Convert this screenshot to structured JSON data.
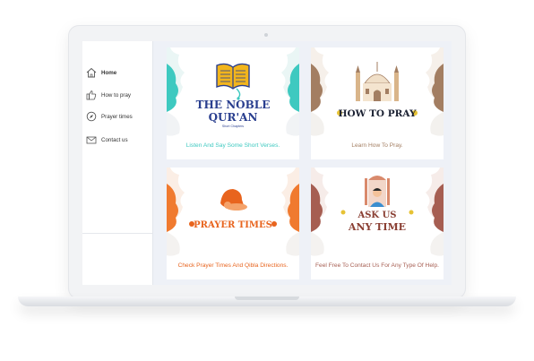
{
  "sidebar": {
    "items": [
      {
        "label": "Home",
        "icon": "home-icon"
      },
      {
        "label": "How to pray",
        "icon": "thumbs-up-icon"
      },
      {
        "label": "Prayer times",
        "icon": "compass-icon"
      },
      {
        "label": "Contact us",
        "icon": "envelope-icon"
      }
    ]
  },
  "cards": [
    {
      "title_line1": "THE NOBLE",
      "title_line2": "QUR'AN",
      "subtitle": "Short Chapters",
      "caption": "Listen And Say Some Short Verses.",
      "accent": "#3ec9c0",
      "text_color": "#2a3f8f"
    },
    {
      "title_line1": "HOW TO PRAY",
      "caption": "Learn How To Pray.",
      "accent": "#a37e62",
      "text_color": "#1c2233"
    },
    {
      "title_line1": "PRAYER TIMES",
      "caption": "Check Prayer Times And Qibla Directions.",
      "accent": "#f07a2f",
      "text_color": "#e8641e"
    },
    {
      "title_line1": "ASK US",
      "title_line2": "ANY TIME",
      "caption": "Feel Free To Contact Us For Any Type Of Help.",
      "accent": "#a65e52",
      "text_color": "#8a3f33"
    }
  ]
}
